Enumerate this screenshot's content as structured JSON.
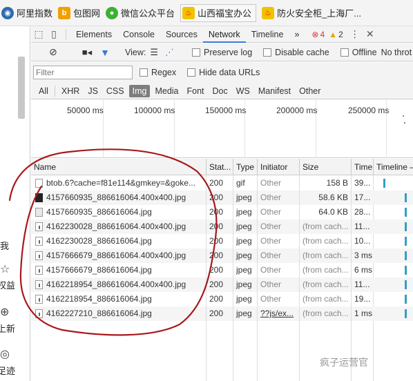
{
  "bookmarks": [
    {
      "label": "阿里指数",
      "icon": "globe-icon"
    },
    {
      "label": "包图网",
      "icon": "b-logo-icon"
    },
    {
      "label": "微信公众平台",
      "icon": "wechat-icon"
    },
    {
      "label": "山西福宝办公",
      "icon": "fire-icon"
    },
    {
      "label": "防火安全柜_上海厂...",
      "icon": "fire-icon"
    }
  ],
  "left_strip": [
    "我",
    "权益",
    "上新",
    "足迹"
  ],
  "devtools": {
    "tabs": [
      "Elements",
      "Console",
      "Sources",
      "Network",
      "Timeline"
    ],
    "active_tab": "Network",
    "more": "»",
    "errors": "4",
    "warnings": "2",
    "close": "✕"
  },
  "toolbar": {
    "view_label": "View:",
    "preserve_log": "Preserve log",
    "disable_cache": "Disable cache",
    "offline": "Offline",
    "throttle": "No throt"
  },
  "filter": {
    "placeholder": "Filter",
    "regex": "Regex",
    "hide_data_urls": "Hide data URLs"
  },
  "types": [
    "All",
    "XHR",
    "JS",
    "CSS",
    "Img",
    "Media",
    "Font",
    "Doc",
    "WS",
    "Manifest",
    "Other"
  ],
  "active_type": "Img",
  "overview_ticks": [
    "50000 ms",
    "100000 ms",
    "150000 ms",
    "200000 ms",
    "250000 ms"
  ],
  "columns": [
    "Name",
    "Stat...",
    "Type",
    "Initiator",
    "Size",
    "Time",
    "Timeline –"
  ],
  "rows": [
    {
      "name": "btob.6?cache=f81e114&gmkey=&goke...",
      "status": "200",
      "type": "gif",
      "initiator": "Other",
      "size": "158 B",
      "time": "39..."
    },
    {
      "name": "4157660935_886616064.400x400.jpg",
      "status": "200",
      "type": "jpeg",
      "initiator": "Other",
      "size": "58.6 KB",
      "time": "17..."
    },
    {
      "name": "4157660935_886616064.jpg",
      "status": "200",
      "type": "jpeg",
      "initiator": "Other",
      "size": "64.0 KB",
      "time": "28..."
    },
    {
      "name": "4162230028_886616064.400x400.jpg",
      "status": "200",
      "type": "jpeg",
      "initiator": "Other",
      "size": "(from cach...",
      "time": "11..."
    },
    {
      "name": "4162230028_886616064.jpg",
      "status": "200",
      "type": "jpeg",
      "initiator": "Other",
      "size": "(from cach...",
      "time": "10..."
    },
    {
      "name": "4157666679_886616064.400x400.jpg",
      "status": "200",
      "type": "jpeg",
      "initiator": "Other",
      "size": "(from cach...",
      "time": "3 ms"
    },
    {
      "name": "4157666679_886616064.jpg",
      "status": "200",
      "type": "jpeg",
      "initiator": "Other",
      "size": "(from cach...",
      "time": "6 ms"
    },
    {
      "name": "4162218954_886616064.400x400.jpg",
      "status": "200",
      "type": "jpeg",
      "initiator": "Other",
      "size": "(from cach...",
      "time": "11..."
    },
    {
      "name": "4162218954_886616064.jpg",
      "status": "200",
      "type": "jpeg",
      "initiator": "Other",
      "size": "(from cach...",
      "time": "19..."
    },
    {
      "name": "4162227210_886616064.jpg",
      "status": "200",
      "type": "jpeg",
      "initiator": "??js/ex...",
      "size": "(from cach...",
      "time": "1 ms"
    }
  ],
  "watermark": "疯子运营官",
  "accent": "#3879d9"
}
